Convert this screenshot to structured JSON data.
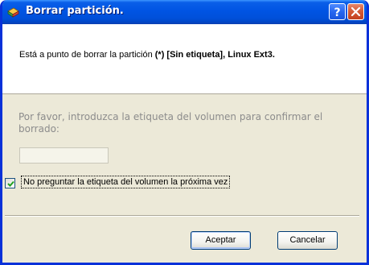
{
  "window": {
    "title": "Borrar partición.",
    "help_button": "?",
    "close_button": "close"
  },
  "message": {
    "prefix": "Está a punto de borrar la partición ",
    "partition": "(*) [Sin etiqueta], Linux Ext3."
  },
  "form": {
    "prompt": "Por favor, introduzca la etiqueta del volumen para confirmar el borrado:",
    "label_input_value": "",
    "checkbox_checked": true,
    "checkbox_label": "No preguntar la etiqueta del volumen la próxima vez"
  },
  "buttons": {
    "ok": "Aceptar",
    "cancel": "Cancelar"
  },
  "colors": {
    "titlebar": "#0054E3",
    "dialog_bg": "#ECE9D8",
    "disabled_text": "#8C8C8C"
  }
}
